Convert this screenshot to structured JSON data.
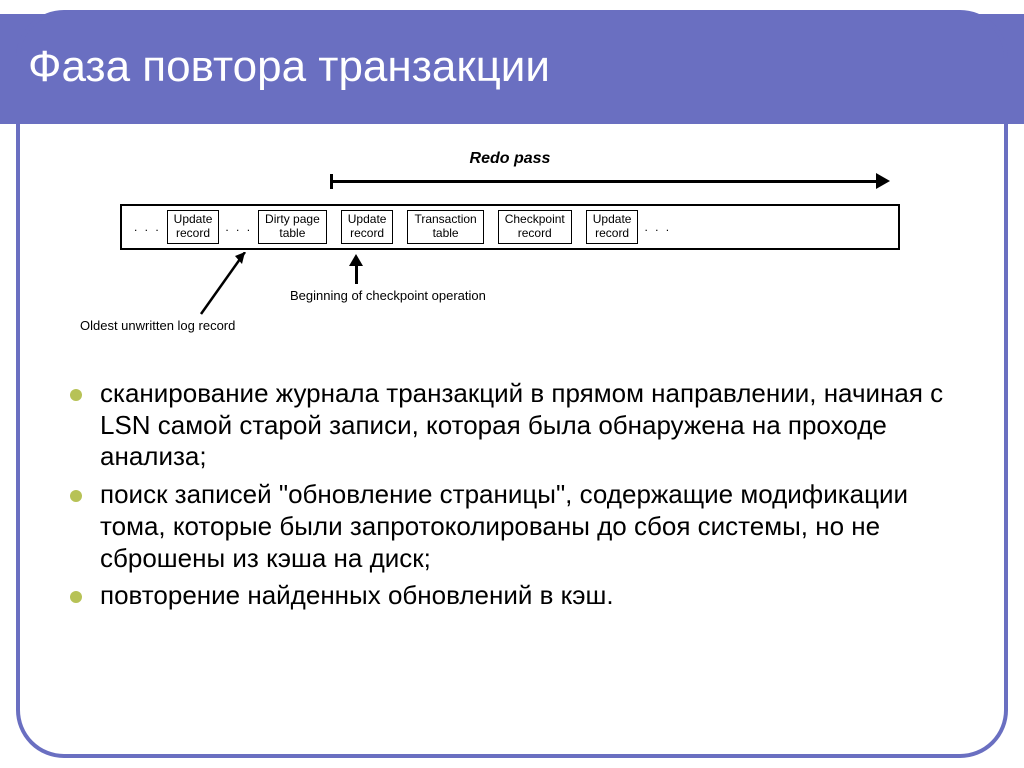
{
  "title": "Фаза повтора транзакции",
  "diagram": {
    "redo_label": "Redo pass",
    "cells": [
      "Update\nrecord",
      "Dirty page\ntable",
      "Update\nrecord",
      "Transaction\ntable",
      "Checkpoint\nrecord",
      "Update\nrecord"
    ],
    "ellipsis": ". . .",
    "annotation_oldest": "Oldest unwritten log record",
    "annotation_checkpoint": "Beginning of checkpoint operation"
  },
  "bullets": [
    "сканирование журнала транзакций в прямом направлении, начиная с LSN самой старой записи, которая была обнаружена на проходе анализа;",
    "поиск записей \"обновление страницы\", содержащие модификации тома, которые были запротоколированы до сбоя системы, но не сброшены из кэша на диск;",
    "повторение найденных обновлений в кэш."
  ],
  "chart_data": {
    "type": "table",
    "title": "Redo pass over log records",
    "records": [
      {
        "index": 0,
        "label": "Update record"
      },
      {
        "index": 1,
        "label": "Dirty page table"
      },
      {
        "index": 2,
        "label": "Update record"
      },
      {
        "index": 3,
        "label": "Transaction table"
      },
      {
        "index": 4,
        "label": "Checkpoint record"
      },
      {
        "index": 5,
        "label": "Update record"
      }
    ],
    "arrow_span": {
      "from_index": 1,
      "to_index": 5,
      "direction": "right",
      "label": "Redo pass"
    },
    "annotations": [
      {
        "target_index": 0,
        "text": "Oldest unwritten log record"
      },
      {
        "target_index": 1,
        "text": "Beginning of checkpoint operation"
      }
    ]
  }
}
